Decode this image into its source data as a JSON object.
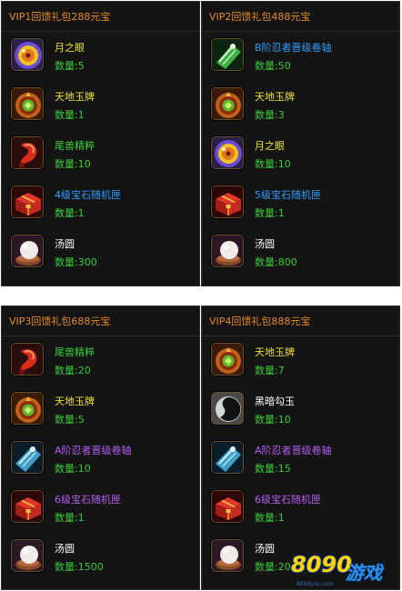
{
  "panels": [
    {
      "title": "VIP1回馈礼包288元宝",
      "items": [
        {
          "name": "月之眼",
          "qty": "数量:5",
          "color": "yellow",
          "icon": "moon-eye-icon"
        },
        {
          "name": "天地玉牌",
          "qty": "数量:1",
          "color": "yellow",
          "icon": "jade-token-icon"
        },
        {
          "name": "尾兽精粹",
          "qty": "数量:10",
          "color": "green",
          "icon": "beast-essence-icon"
        },
        {
          "name": "4级宝石随机匣",
          "qty": "数量:1",
          "color": "blue",
          "icon": "gem-chest-icon"
        },
        {
          "name": "汤圆",
          "qty": "数量:300",
          "color": "white",
          "icon": "tangyuan-icon"
        }
      ]
    },
    {
      "title": "VIP2回馈礼包488元宝",
      "items": [
        {
          "name": "B阶忍者晋级卷轴",
          "qty": "数量:50",
          "color": "blue",
          "icon": "green-scroll-icon"
        },
        {
          "name": "天地玉牌",
          "qty": "数量:3",
          "color": "yellow",
          "icon": "jade-token-icon"
        },
        {
          "name": "月之眼",
          "qty": "数量:10",
          "color": "yellow",
          "icon": "moon-eye-icon"
        },
        {
          "name": "5级宝石随机匣",
          "qty": "数量:1",
          "color": "blue",
          "icon": "gem-chest-icon"
        },
        {
          "name": "汤圆",
          "qty": "数量:800",
          "color": "white",
          "icon": "tangyuan-icon"
        }
      ]
    },
    {
      "title": "VIP3回馈礼包688元宝",
      "items": [
        {
          "name": "尾兽精粹",
          "qty": "数量:20",
          "color": "green",
          "icon": "beast-essence-icon"
        },
        {
          "name": "天地玉牌",
          "qty": "数量:5",
          "color": "yellow",
          "icon": "jade-token-icon"
        },
        {
          "name": "A阶忍者晋级卷轴",
          "qty": "数量:10",
          "color": "purple",
          "icon": "blue-scroll-icon"
        },
        {
          "name": "6级宝石随机匣",
          "qty": "数量:1",
          "color": "purple",
          "icon": "gem-chest-icon"
        },
        {
          "name": "汤圆",
          "qty": "数量:1500",
          "color": "white",
          "icon": "tangyuan-icon"
        }
      ]
    },
    {
      "title": "VIP4回馈礼包888元宝",
      "items": [
        {
          "name": "天地玉牌",
          "qty": "数量:7",
          "color": "yellow",
          "icon": "jade-token-icon"
        },
        {
          "name": "黑暗勾玉",
          "qty": "数量:10",
          "color": "white",
          "icon": "dark-magatama-icon"
        },
        {
          "name": "A阶忍者晋级卷轴",
          "qty": "数量:15",
          "color": "purple",
          "icon": "blue-scroll-icon"
        },
        {
          "name": "6级宝石随机匣",
          "qty": "数量:1",
          "color": "purple",
          "icon": "gem-chest-icon"
        },
        {
          "name": "汤圆",
          "qty": "数量:20",
          "color": "white",
          "icon": "tangyuan-icon"
        }
      ]
    }
  ],
  "watermark": {
    "main": "8090",
    "sub": "游戏",
    "url": "8090yxs.com"
  },
  "colors": {
    "title": "#e58a25",
    "yellow": "#e8e230",
    "green": "#3ccd3c",
    "blue": "#2d9fff",
    "purple": "#b45ef0",
    "white": "#ffffff",
    "qty": "#39cc39",
    "panel_bg": "#141414"
  }
}
